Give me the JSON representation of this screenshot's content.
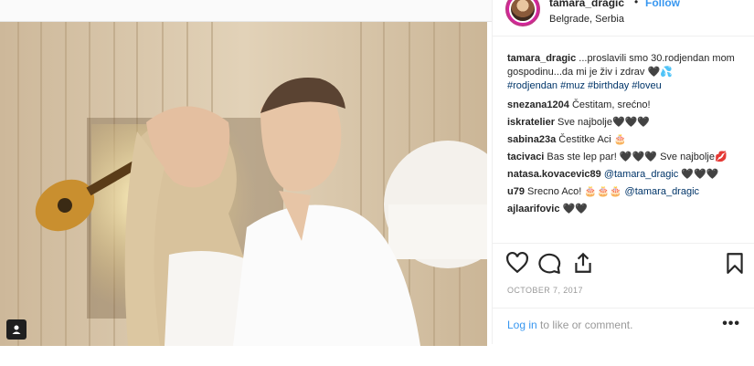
{
  "post": {
    "username": "tamara_dragic",
    "separator": "•",
    "follow_label": "Follow",
    "location": "Belgrade, Serbia",
    "caption": {
      "username": "tamara_dragic",
      "text": " ...proslavili smo 30.rodjendan mom gospodinu...da mi je živ i zdrav 🖤💦",
      "hashtags": "#rodjendan #muz #birthday #loveu"
    },
    "comments": [
      {
        "user": "snezana1204",
        "text": " Čestitam, srećno!",
        "mention": "",
        "after": ""
      },
      {
        "user": "iskratelier",
        "text": " Sve najbolje🖤🖤🖤",
        "mention": "",
        "after": ""
      },
      {
        "user": "sabina23a",
        "text": " Čestitke Aci 🎂",
        "mention": "",
        "after": ""
      },
      {
        "user": "tacivaci",
        "text": " Bas ste lep par! 🖤🖤🖤 Sve najbolje💋",
        "mention": "",
        "after": ""
      },
      {
        "user": "natasa.kovacevic89",
        "text": " ",
        "mention": "@tamara_dragic",
        "after": " 🖤🖤🖤"
      },
      {
        "user": "u79",
        "text": " Srecno Aco! 🎂🎂🎂 ",
        "mention": "@tamara_dragic",
        "after": ""
      },
      {
        "user": "ajlaarifovic",
        "text": " 🖤🖤",
        "mention": "",
        "after": ""
      }
    ],
    "date": "OCTOBER 7, 2017",
    "footer": {
      "login_label": "Log in",
      "login_rest": " to like or comment.",
      "more_label": "•••"
    }
  },
  "icons": {
    "like": "heart-icon",
    "comment": "comment-icon",
    "share": "share-icon",
    "save": "bookmark-icon",
    "tag": "user-tag-icon"
  },
  "colors": {
    "accent": "#3897f0",
    "text": "#262626",
    "muted": "#999999",
    "hashtag": "#003569"
  }
}
